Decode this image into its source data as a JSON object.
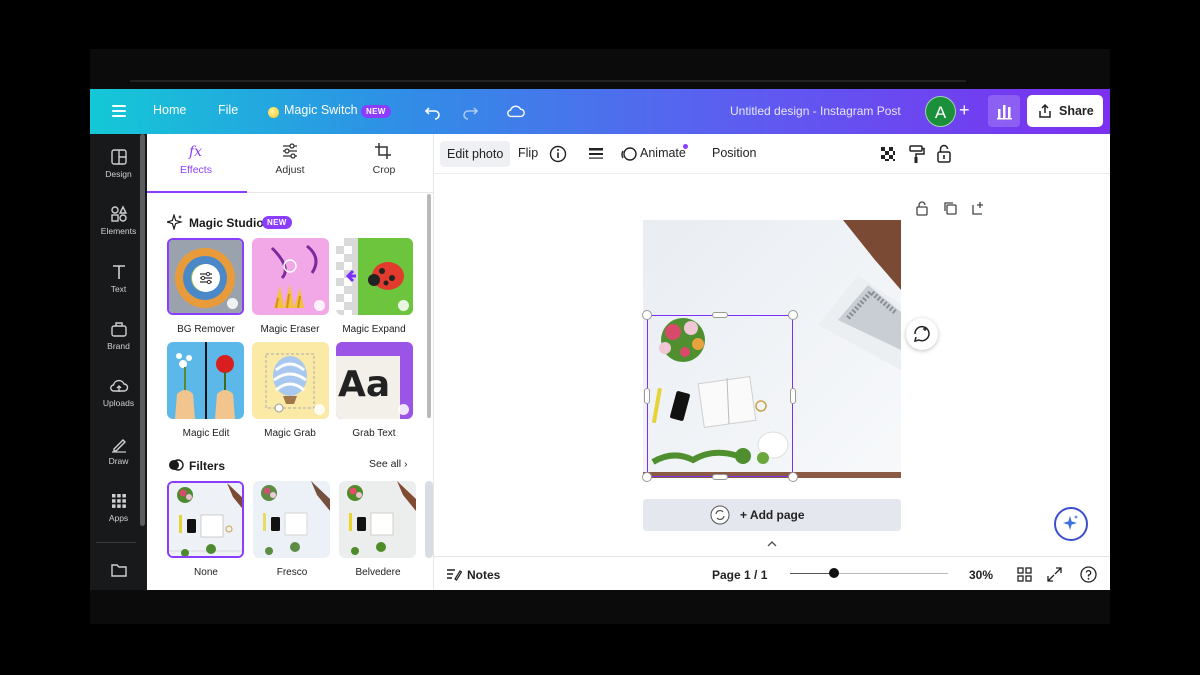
{
  "header": {
    "home": "Home",
    "file": "File",
    "magic_switch": "Magic Switch",
    "new_badge": "NEW",
    "doc_title": "Untitled design - Instagram Post",
    "avatar_initial": "A",
    "plus": "+",
    "share": "Share"
  },
  "rail": {
    "items": [
      {
        "label": "Design",
        "icon": "design-icon"
      },
      {
        "label": "Elements",
        "icon": "elements-icon"
      },
      {
        "label": "Text",
        "icon": "text-icon"
      },
      {
        "label": "Brand",
        "icon": "brand-icon"
      },
      {
        "label": "Uploads",
        "icon": "uploads-icon"
      },
      {
        "label": "Draw",
        "icon": "draw-icon"
      },
      {
        "label": "Apps",
        "icon": "apps-icon"
      }
    ]
  },
  "panel": {
    "tabs": [
      {
        "label": "Effects",
        "icon": "fx-icon"
      },
      {
        "label": "Adjust",
        "icon": "sliders-icon"
      },
      {
        "label": "Crop",
        "icon": "crop-icon"
      }
    ],
    "magic_studio": {
      "title": "Magic Studio",
      "badge": "NEW",
      "tools": [
        {
          "label": "BG Remover"
        },
        {
          "label": "Magic Eraser"
        },
        {
          "label": "Magic Expand"
        },
        {
          "label": "Magic Edit"
        },
        {
          "label": "Magic Grab"
        },
        {
          "label": "Grab Text"
        }
      ],
      "grab_text_sample": "Aa"
    },
    "filters": {
      "title": "Filters",
      "see_all": "See all",
      "items": [
        {
          "label": "None"
        },
        {
          "label": "Fresco"
        },
        {
          "label": "Belvedere"
        }
      ]
    }
  },
  "toolbar": {
    "edit_photo": "Edit photo",
    "flip": "Flip",
    "animate": "Animate",
    "position": "Position"
  },
  "canvas": {
    "add_page": "+ Add page"
  },
  "bottombar": {
    "notes": "Notes",
    "page": "Page 1 / 1",
    "zoom": "30%",
    "zoom_level": 0.28
  },
  "colors": {
    "accent": "#8b3dff",
    "rail_bg": "#18191b",
    "canvas_bg": "#ebecf0"
  }
}
